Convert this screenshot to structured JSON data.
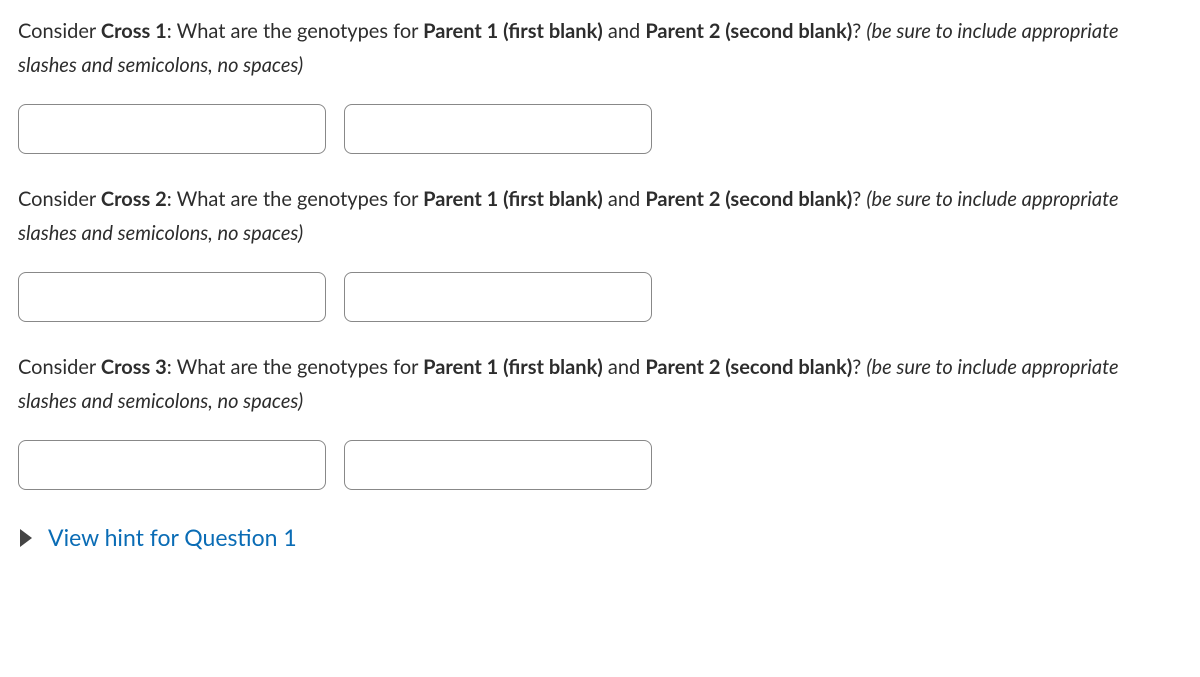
{
  "questions": [
    {
      "intro": "Consider ",
      "crossLabel": "Cross 1",
      "midA": ": What are the genotypes for ",
      "parent1": "Parent 1 (first blank)",
      "midB": " and ",
      "parent2": "Parent 2 (second blank)",
      "midC": "? ",
      "tail": "(be sure to include appropriate slashes and semicolons, no spaces)",
      "input1": "",
      "input2": ""
    },
    {
      "intro": "Consider ",
      "crossLabel": "Cross 2",
      "midA": ": What are the genotypes for ",
      "parent1": "Parent 1 (first blank)",
      "midB": " and ",
      "parent2": "Parent 2 (second blank)",
      "midC": "? ",
      "tail": "(be sure to include appropriate slashes and semicolons, no spaces)",
      "input1": "",
      "input2": ""
    },
    {
      "intro": "Consider ",
      "crossLabel": "Cross 3",
      "midA": ": What are the genotypes for ",
      "parent1": "Parent 1 (first blank)",
      "midB": " and ",
      "parent2": "Parent 2 (second blank)",
      "midC": "? ",
      "tail": "(be sure to include appropriate slashes and semicolons, no spaces)",
      "input1": "",
      "input2": ""
    }
  ],
  "hint": {
    "label": "View hint for Question 1"
  }
}
